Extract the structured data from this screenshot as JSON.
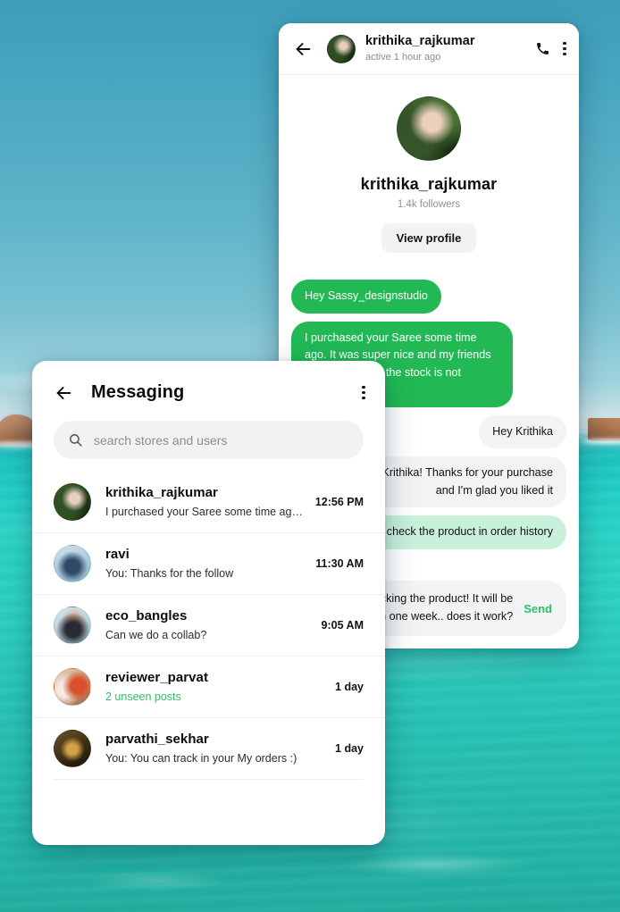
{
  "chat": {
    "header": {
      "back_icon": "arrow-left-icon",
      "name": "krithika_rajkumar",
      "status": "active 1 hour ago",
      "call_icon": "phone-icon",
      "menu_icon": "kebab-menu-icon"
    },
    "profile": {
      "name": "krithika_rajkumar",
      "followers": "1.4k followers",
      "view_profile_label": "View profile"
    },
    "messages": [
      {
        "direction": "in",
        "style": "green",
        "text": "Hey Sassy_designstudio"
      },
      {
        "direction": "in",
        "style": "green",
        "text": "I purchased your Saree some time ago. It was super nice and my friends liked it but I see the stock is not available."
      },
      {
        "direction": "out",
        "style": "grey",
        "text": "Hey Krithika"
      },
      {
        "direction": "out",
        "style": "grey",
        "text": "Hey Krithika! Thanks for your purchase and I'm glad you liked it"
      },
      {
        "direction": "out",
        "style": "mint",
        "text": "You can check the product in order history"
      }
    ],
    "composer": {
      "text": "We are restocking the product! It will be available in one week.. does it work?",
      "send_label": "Send"
    }
  },
  "messaging": {
    "back_icon": "arrow-left-icon",
    "title": "Messaging",
    "menu_icon": "kebab-menu-icon",
    "search": {
      "icon": "search-icon",
      "placeholder": "search stores and users",
      "value": ""
    },
    "conversations": [
      {
        "avatar": "av-krithika",
        "name": "krithika_rajkumar",
        "preview": "I purchased your Saree some time ago. It w..",
        "preview_style": "normal",
        "time": "12:56 PM"
      },
      {
        "avatar": "av-ravi",
        "name": "ravi",
        "preview": "You: Thanks for the follow",
        "preview_style": "normal",
        "time": "11:30 AM"
      },
      {
        "avatar": "av-eco",
        "name": "eco_bangles",
        "preview": "Can we do a collab?",
        "preview_style": "normal",
        "time": "9:05 AM"
      },
      {
        "avatar": "av-reviewer",
        "name": "reviewer_parvat",
        "preview": "2 unseen posts",
        "preview_style": "unseen",
        "time": "1 day"
      },
      {
        "avatar": "av-parvathi",
        "name": "parvathi_sekhar",
        "preview": "You: You can track in your My orders :)",
        "preview_style": "normal",
        "time": "1 day"
      }
    ]
  },
  "colors": {
    "accent_green": "#22b955",
    "send_green": "#2fbf6a",
    "mint_bubble": "#c8f0da",
    "grey_bubble": "#f2f3f4",
    "sea": "#2bd3c6",
    "sky": "#5db3c8"
  }
}
